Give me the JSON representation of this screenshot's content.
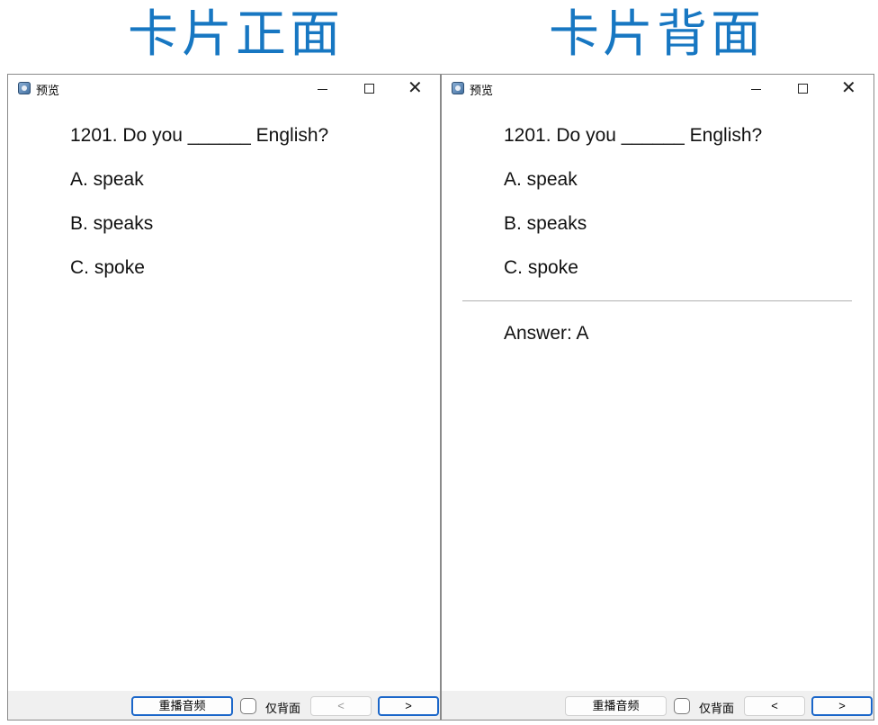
{
  "headings": {
    "front": "卡片正面",
    "back": "卡片背面"
  },
  "window": {
    "title": "预览",
    "minimize_glyph": "—",
    "maximize_glyph": "☐",
    "close_glyph": "✕"
  },
  "card": {
    "question": "1201. Do you ______ English?",
    "options": [
      "A. speak",
      "B. speaks",
      "C. spoke"
    ],
    "answer": "Answer: A"
  },
  "footer": {
    "replay_label": "重播音频",
    "back_only_label": "仅背面",
    "back_only_checked": false,
    "prev_label": "<",
    "next_label": ">"
  },
  "colors": {
    "heading": "#1777c2",
    "primary_border": "#1a66c9",
    "footer_bg": "#f0f0f0"
  },
  "icons": {
    "app": "app-icon",
    "minimize": "minimize-icon",
    "maximize": "maximize-icon",
    "close": "close-icon"
  }
}
